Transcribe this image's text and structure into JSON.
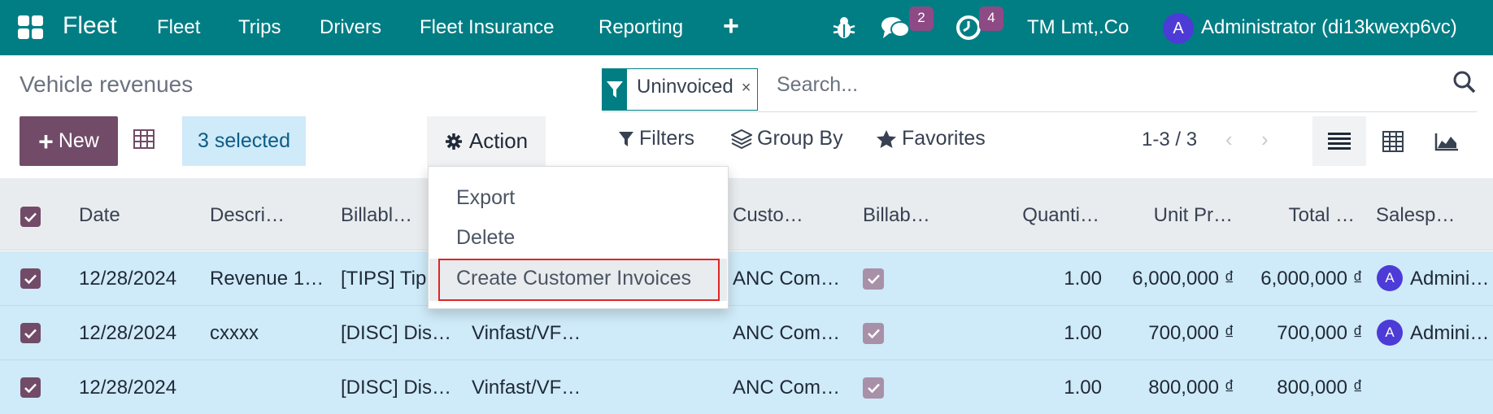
{
  "navbar": {
    "brand": "Fleet",
    "menu": [
      "Fleet",
      "Trips",
      "Drivers",
      "Fleet Insurance",
      "Reporting"
    ],
    "messages_count": "2",
    "activities_count": "4",
    "company": "TM Lmt,.Co",
    "user_initial": "A",
    "user_name": "Administrator (di13kwexp6vc)",
    "accent_color": "#017e84"
  },
  "control_panel": {
    "title": "Vehicle revenues",
    "facet_label": "Uninvoiced",
    "facet_close": "×",
    "search_placeholder": "Search...",
    "new_label": "New",
    "selected_label": "3 selected",
    "action_label": "Action",
    "filters_label": "Filters",
    "group_by_label": "Group By",
    "favorites_label": "Favorites",
    "pager": "1-3 / 3",
    "pager_prev": "‹",
    "pager_next": "›"
  },
  "action_menu": {
    "items": [
      "Export",
      "Delete",
      "Create Customer Invoices"
    ],
    "highlighted_index": 2
  },
  "table": {
    "headers": [
      "Date",
      "Descri…",
      "Billabl…",
      "Custo…",
      "Billab…",
      "Quanti…",
      "Unit Pr…",
      "Total …",
      "Salesp…"
    ],
    "rows": [
      {
        "date": "12/28/2024",
        "description": "Revenue 1…",
        "billable_product": "[TIPS] Tip",
        "vehicle": "",
        "customer": "ANC Com…",
        "quantity": "1.00",
        "unit_price": "6,000,000 ₫",
        "total": "6,000,000 ₫",
        "salesperson_initial": "A",
        "salesperson": "Admini…"
      },
      {
        "date": "12/28/2024",
        "description": "cxxxx",
        "billable_product": "[DISC] Dis…",
        "vehicle": "Vinfast/VF…",
        "customer": "ANC Com…",
        "quantity": "1.00",
        "unit_price": "700,000 ₫",
        "total": "700,000 ₫",
        "salesperson_initial": "A",
        "salesperson": "Admini…"
      },
      {
        "date": "12/28/2024",
        "description": "",
        "billable_product": "[DISC] Dis…",
        "vehicle": "Vinfast/VF…",
        "customer": "ANC Com…",
        "quantity": "1.00",
        "unit_price": "800,000 ₫",
        "total": "800,000 ₫",
        "salesperson_initial": "",
        "salesperson": ""
      }
    ]
  }
}
